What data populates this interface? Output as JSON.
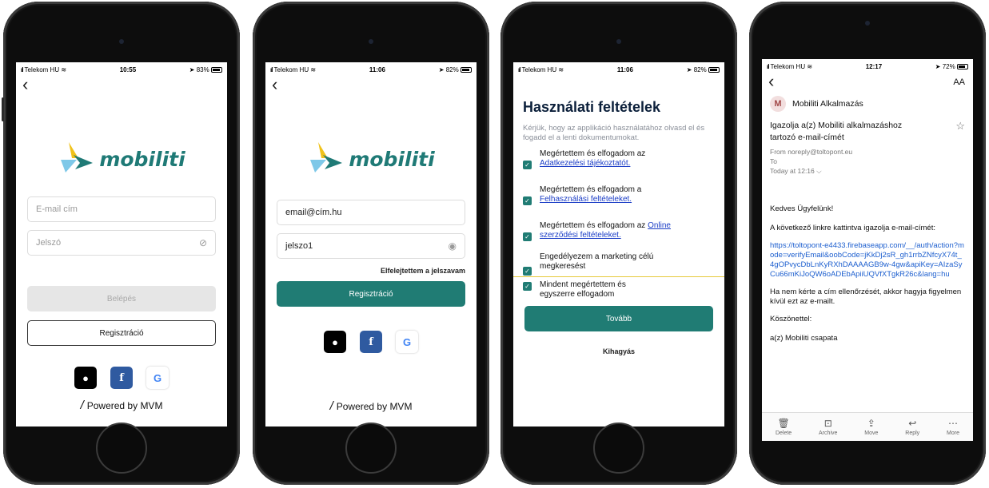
{
  "phones": [
    {
      "status": {
        "carrier": "Telekom HU",
        "time": "10:55",
        "battery": "83%"
      },
      "logo_text": "mobiliti",
      "email_placeholder": "E-mail cím",
      "password_placeholder": "Jelszó",
      "login_label": "Belépés",
      "register_label": "Regisztráció",
      "social": {
        "apple": "",
        "facebook": "f",
        "google": "G"
      },
      "powered_by": "Powered by MVM"
    },
    {
      "status": {
        "carrier": "Telekom HU",
        "time": "11:06",
        "battery": "82%"
      },
      "logo_text": "mobiliti",
      "email_value": "email@cím.hu",
      "password_value": "jelszo1",
      "forgot_label": "Elfelejtettem a jelszavam",
      "register_label": "Regisztráció",
      "social": {
        "apple": "",
        "facebook": "f",
        "google": "G"
      },
      "powered_by": "Powered by MVM"
    },
    {
      "status": {
        "carrier": "Telekom HU",
        "time": "11:06",
        "battery": "82%"
      },
      "title": "Használati feltételek",
      "intro": "Kérjük, hogy az applikáció használatához olvasd el és fogadd el a lenti dokumentumokat.",
      "items": [
        {
          "text": "Megértettem és elfogadom az",
          "link": "Adatkezelési tájékoztatót."
        },
        {
          "text": "Megértettem és elfogadom a",
          "link": "Felhasználási feltételeket."
        },
        {
          "text": "Megértettem és elfogadom az",
          "link": "Online szerződési feltételeket."
        },
        {
          "text": "Engedélyezem a marketing célú megkeresést",
          "link": ""
        }
      ],
      "accept_all": "Mindent megértettem és egyszerre elfogadom",
      "next_label": "Tovább",
      "skip_label": "Kihagyás"
    },
    {
      "status": {
        "carrier": "Telekom HU",
        "time": "12:17",
        "battery": "72%"
      },
      "aa": "AA",
      "sender_name": "Mobiliti Alkalmazás",
      "subject": "Igazolja a(z) Mobiliti alkalmazáshoz tartozó e-mail-címét",
      "from": "From noreply@toltopont.eu",
      "to": "To",
      "date": "Today at 12:16 ⌵",
      "greeting": "Kedves Ügyfelünk!",
      "instruction": "A következő linkre kattintva igazolja e-mail-címét:",
      "link": "https://toltopont-e4433.firebaseapp.com/__/auth/action?mode=verifyEmail&oobCode=jKkDj2sR_gh1rrbZNfcyX74t_4gOPvycDbLnKyRXhDAAAAGB9w-4gw&apiKey=AIzaSyCu66mKiJoQW6oADEbApiiUQVfXTgkR26c&lang=hu",
      "ignore_text": "Ha nem kérte a cím ellenőrzését, akkor hagyja figyelmen kívül ezt az e-mailt.",
      "thanks": "Köszönettel:",
      "signature": "a(z) Mobiliti csapata",
      "toolbar": [
        "Delete",
        "Archive",
        "Move",
        "Reply",
        "More"
      ]
    }
  ]
}
